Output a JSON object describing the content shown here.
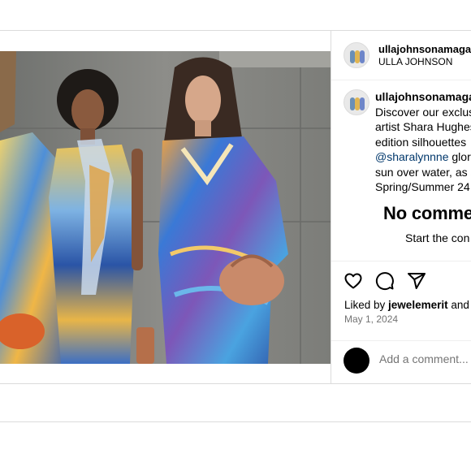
{
  "post": {
    "username": "ullajohnsonamaga",
    "display_name": "ULLA JOHNSON",
    "caption_username": "ullajohnsonamaga",
    "caption_lines": [
      "Discover our exclus",
      "artist Shara Hughes",
      "edition silhouettes"
    ],
    "mention": "@sharalynnne",
    "mention_rest": " glori",
    "caption_lines_after": [
      "sun over water, as s",
      "Spring/Summer 24"
    ],
    "photo_alt": "Three models wearing colorful painted-print dresses in front of a concrete wall"
  },
  "comments": {
    "empty_title": "No comme",
    "empty_subtitle": "Start the con"
  },
  "actions": {
    "like_icon": "heart-icon",
    "comment_icon": "comment-icon",
    "share_icon": "share-icon"
  },
  "likes": {
    "prefix": "Liked by ",
    "user": "jewelemerit",
    "suffix": " and"
  },
  "date": "May 1, 2024",
  "comment_box": {
    "placeholder": "Add a comment..."
  }
}
